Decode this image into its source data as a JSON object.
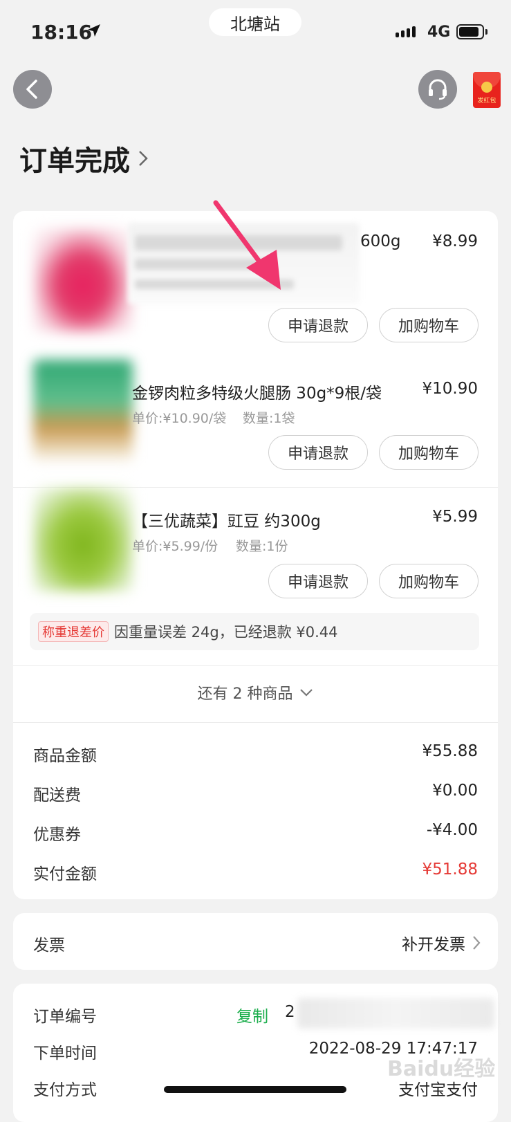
{
  "status_bar": {
    "time": "18:16",
    "location": "北塘站",
    "network": "4G"
  },
  "header": {
    "hongbao_label": "发红包",
    "title": "订单完成"
  },
  "products": [
    {
      "name_suffix": "600g",
      "price": "¥8.99",
      "name_blurred": true
    },
    {
      "name": "金锣肉粒多特级火腿肠 30g*9根/袋",
      "price": "¥10.90",
      "unit_price": "单价:¥10.90/袋",
      "quantity": "数量:1袋"
    },
    {
      "name": "【三优蔬菜】豇豆 约300g",
      "price": "¥5.99",
      "unit_price": "单价:¥5.99/份",
      "quantity": "数量:1份"
    }
  ],
  "buttons": {
    "refund": "申请退款",
    "add_cart": "加购物车"
  },
  "weight_notice": {
    "tag": "称重退差价",
    "text": "因重量误差 24g，已经退款 ¥0.44"
  },
  "more_items": "还有 2 种商品",
  "summary": [
    {
      "label": "商品金额",
      "value": "¥55.88"
    },
    {
      "label": "配送费",
      "value": "¥0.00"
    },
    {
      "label": "优惠券",
      "value": "-¥4.00"
    },
    {
      "label": "实付金额",
      "value": "¥51.88"
    }
  ],
  "invoice": {
    "label": "发票",
    "action": "补开发票"
  },
  "order_info": {
    "order_no_label": "订单编号",
    "copy": "复制",
    "order_no_visible": "2",
    "time_label": "下单时间",
    "time_value": "2022-08-29 17:47:17",
    "pay_label": "支付方式",
    "pay_value": "支付宝支付"
  },
  "watermark": "Baidu经验",
  "colors": {
    "accent_red": "#e53935",
    "copy_green": "#1aad4b",
    "arrow_pink": "#f0366e"
  }
}
